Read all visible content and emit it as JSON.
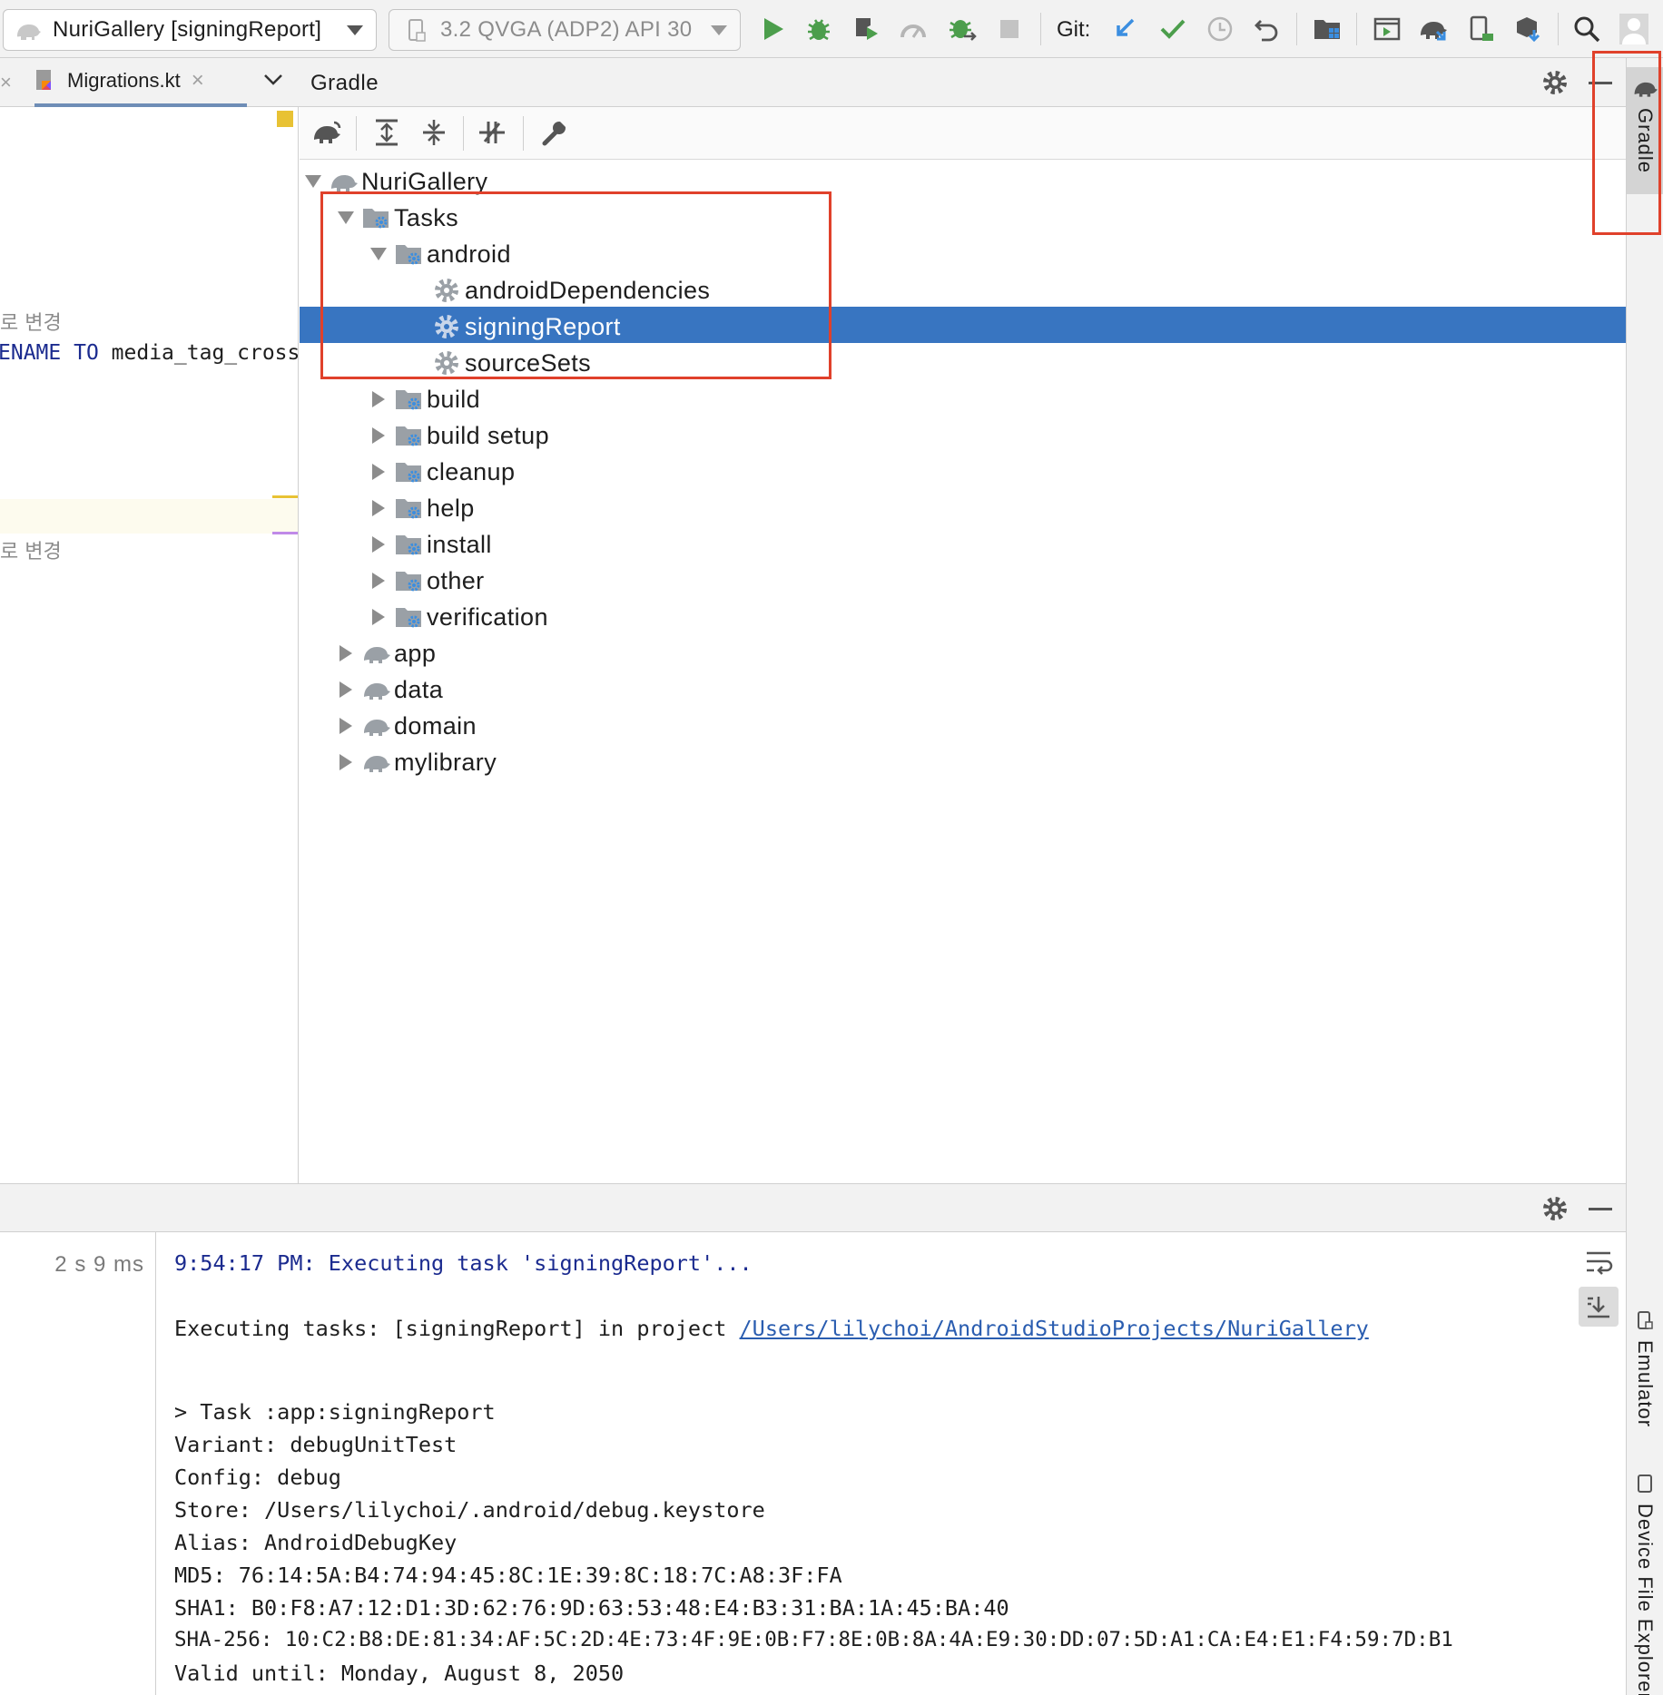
{
  "toolbar": {
    "run_config": "NuriGallery [signingReport]",
    "device": "3.2  QVGA (ADP2) API 30",
    "git_label": "Git:"
  },
  "editor": {
    "tab_label": "Migrations.kt",
    "comment_1": "로 변경",
    "code_keyword_1": "ENAME",
    "code_keyword_2": "TO",
    "code_text": "media_tag_cross",
    "comment_2": "로 변경"
  },
  "gradle": {
    "title": "Gradle",
    "tree": {
      "root": "NuriGallery",
      "tasks": "Tasks",
      "android": "android",
      "android_tasks": [
        "androidDependencies",
        "signingReport",
        "sourceSets"
      ],
      "task_groups": [
        "build",
        "build setup",
        "cleanup",
        "help",
        "install",
        "other",
        "verification"
      ],
      "modules": [
        "app",
        "data",
        "domain",
        "mylibrary"
      ]
    }
  },
  "right_strip": {
    "gradle_tab": "Gradle",
    "emulator_tab": "Emulator",
    "device_explorer_tab": "Device File Explorer"
  },
  "console": {
    "timing": "2 s 9 ms",
    "header_line": "9:54:17 PM: Executing task 'signingReport'...",
    "exec_prefix": "Executing tasks: [signingReport] in project ",
    "exec_link": "/Users/lilychoi/AndroidStudioProjects/NuriGallery",
    "lines": [
      "> Task :app:signingReport",
      "Variant: debugUnitTest",
      "Config: debug",
      "Store: /Users/lilychoi/.android/debug.keystore",
      "Alias: AndroidDebugKey",
      "MD5: 76:14:5A:B4:74:94:45:8C:1E:39:8C:18:7C:A8:3F:FA",
      "SHA1: B0:F8:A7:12:D1:3D:62:76:9D:63:53:48:E4:B3:31:BA:1A:45:BA:40",
      "SHA-256: 10:C2:B8:DE:81:34:AF:5C:2D:4E:73:4F:9E:0B:F7:8E:0B:8A:4A:E9:30:DD:07:5D:A1:CA:E4:E1:F4:59:7D:B1",
      "Valid until: Monday, August 8, 2050"
    ]
  },
  "colors": {
    "selection": "#3875c1",
    "highlight_box": "#e0412b",
    "run_green": "#4c9e4c",
    "link_blue": "#2a5db0",
    "console_blue": "#1b2b8f"
  }
}
